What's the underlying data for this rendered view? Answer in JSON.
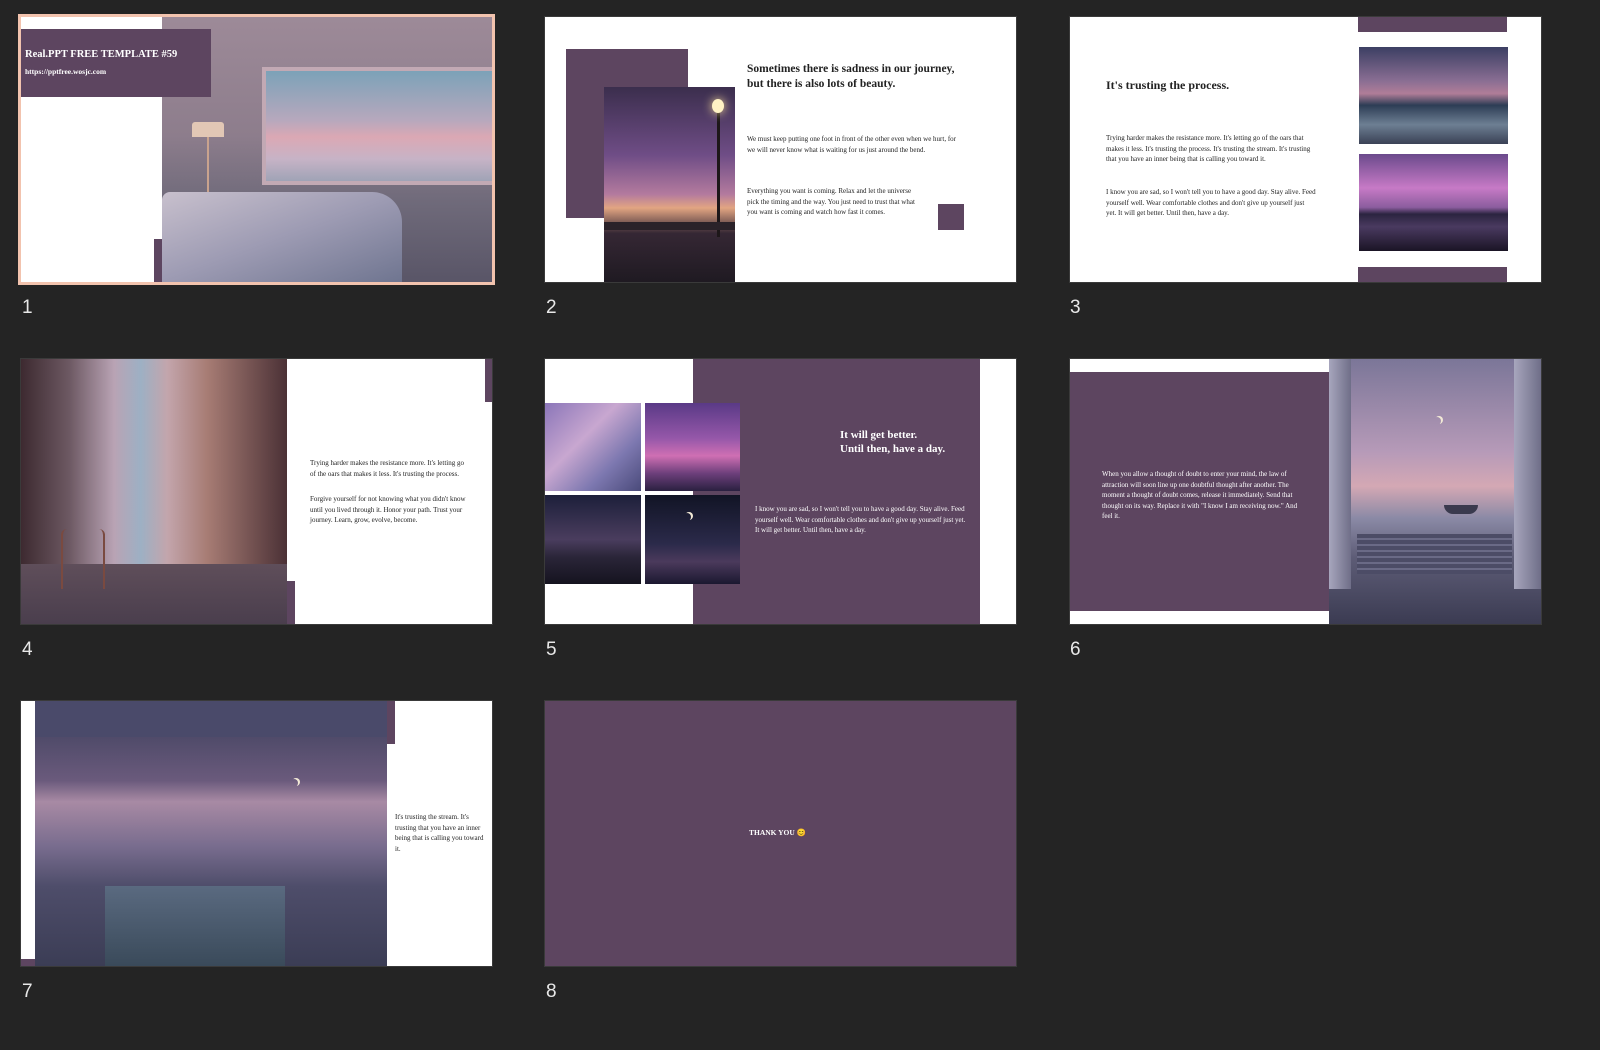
{
  "colors": {
    "background": "#242424",
    "accent": "#5d4560",
    "selected_border": "#f2c3ae"
  },
  "slides": [
    {
      "number": "1",
      "title": "Real.PPT FREE TEMPLATE #59",
      "url": "https://pptfree.wosjc.com",
      "selected": true
    },
    {
      "number": "2",
      "heading": "Sometimes there is sadness in our journey, but there is also lots of beauty.",
      "para1": "We must keep putting one foot in front of the other even when we hurt, for we will never know what is waiting for us just around the bend.",
      "para2": "Everything you want is coming. Relax and let the universe pick the timing and the way. You just need to trust that what you want is coming and watch how fast it comes."
    },
    {
      "number": "3",
      "heading": "It's trusting the process.",
      "para1": "Trying harder makes the resistance more. It's letting go of the oars that makes it less. It's trusting the process. It's trusting the stream. It's trusting that you have an inner being that is calling you toward it.",
      "para2": "I know you are sad, so I won't tell you to have a good day. Stay alive. Feed yourself well. Wear comfortable clothes and don't give up yourself just yet. It will get better. Until then, have a day."
    },
    {
      "number": "4",
      "para1": "Trying harder makes the resistance more. It's letting go of the oars that makes it less. It's trusting the process.",
      "para2": "Forgive yourself for not knowing what you didn't know until you lived through it. Honor your path. Trust your journey. Learn, grow, evolve, become."
    },
    {
      "number": "5",
      "heading_line1": "It will get better.",
      "heading_line2": "Until then, have a day.",
      "para": "I know you are sad, so I won't tell you to have a good day. Stay alive. Feed yourself well. Wear comfortable clothes and don't give up yourself just yet. It will get better. Until then, have a day."
    },
    {
      "number": "6",
      "para": "When you allow a thought of doubt to enter your mind, the law of attraction will soon line up one doubtful thought after another. The moment a thought of doubt comes, release it immediately. Send that thought on its way. Replace it with \"I know I am receiving now.\" And feel it."
    },
    {
      "number": "7",
      "para": "It's trusting the stream. It's trusting that you have an inner being that is calling you toward it."
    },
    {
      "number": "8",
      "text": "THANK YOU 😊"
    }
  ]
}
